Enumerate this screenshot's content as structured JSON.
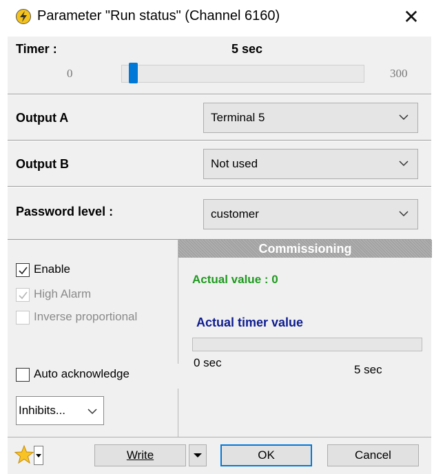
{
  "window": {
    "title": "Parameter \"Run status\" (Channel 6160)"
  },
  "timer": {
    "label": "Timer :",
    "value": "5 sec",
    "min": "0",
    "max": "300",
    "fraction": 0.017
  },
  "rows": [
    {
      "label": "Output A",
      "value": "Terminal 5"
    },
    {
      "label": "Output B",
      "value": "Not used"
    },
    {
      "label": "Password level :",
      "value": "customer"
    }
  ],
  "options": {
    "enable": {
      "label": "Enable",
      "checked": true
    },
    "high_alarm": {
      "label": "High Alarm",
      "checked": true,
      "disabled": true
    },
    "inverse": {
      "label": "Inverse proportional",
      "checked": false,
      "disabled": true
    },
    "auto_ack": {
      "label": "Auto acknowledge",
      "checked": false
    },
    "inhibits": "Inhibits..."
  },
  "commissioning": {
    "header": "Commissioning",
    "actual_value": "Actual value : 0",
    "actual_timer_label": "Actual timer value",
    "progress_min": "0 sec",
    "progress_max": "5 sec",
    "progress_fraction": 0
  },
  "footer": {
    "write": "Write",
    "ok": "OK",
    "cancel": "Cancel"
  },
  "colors": {
    "accent": "#0078d7",
    "green": "#1f9a1f",
    "navy": "#0d1c8f"
  }
}
